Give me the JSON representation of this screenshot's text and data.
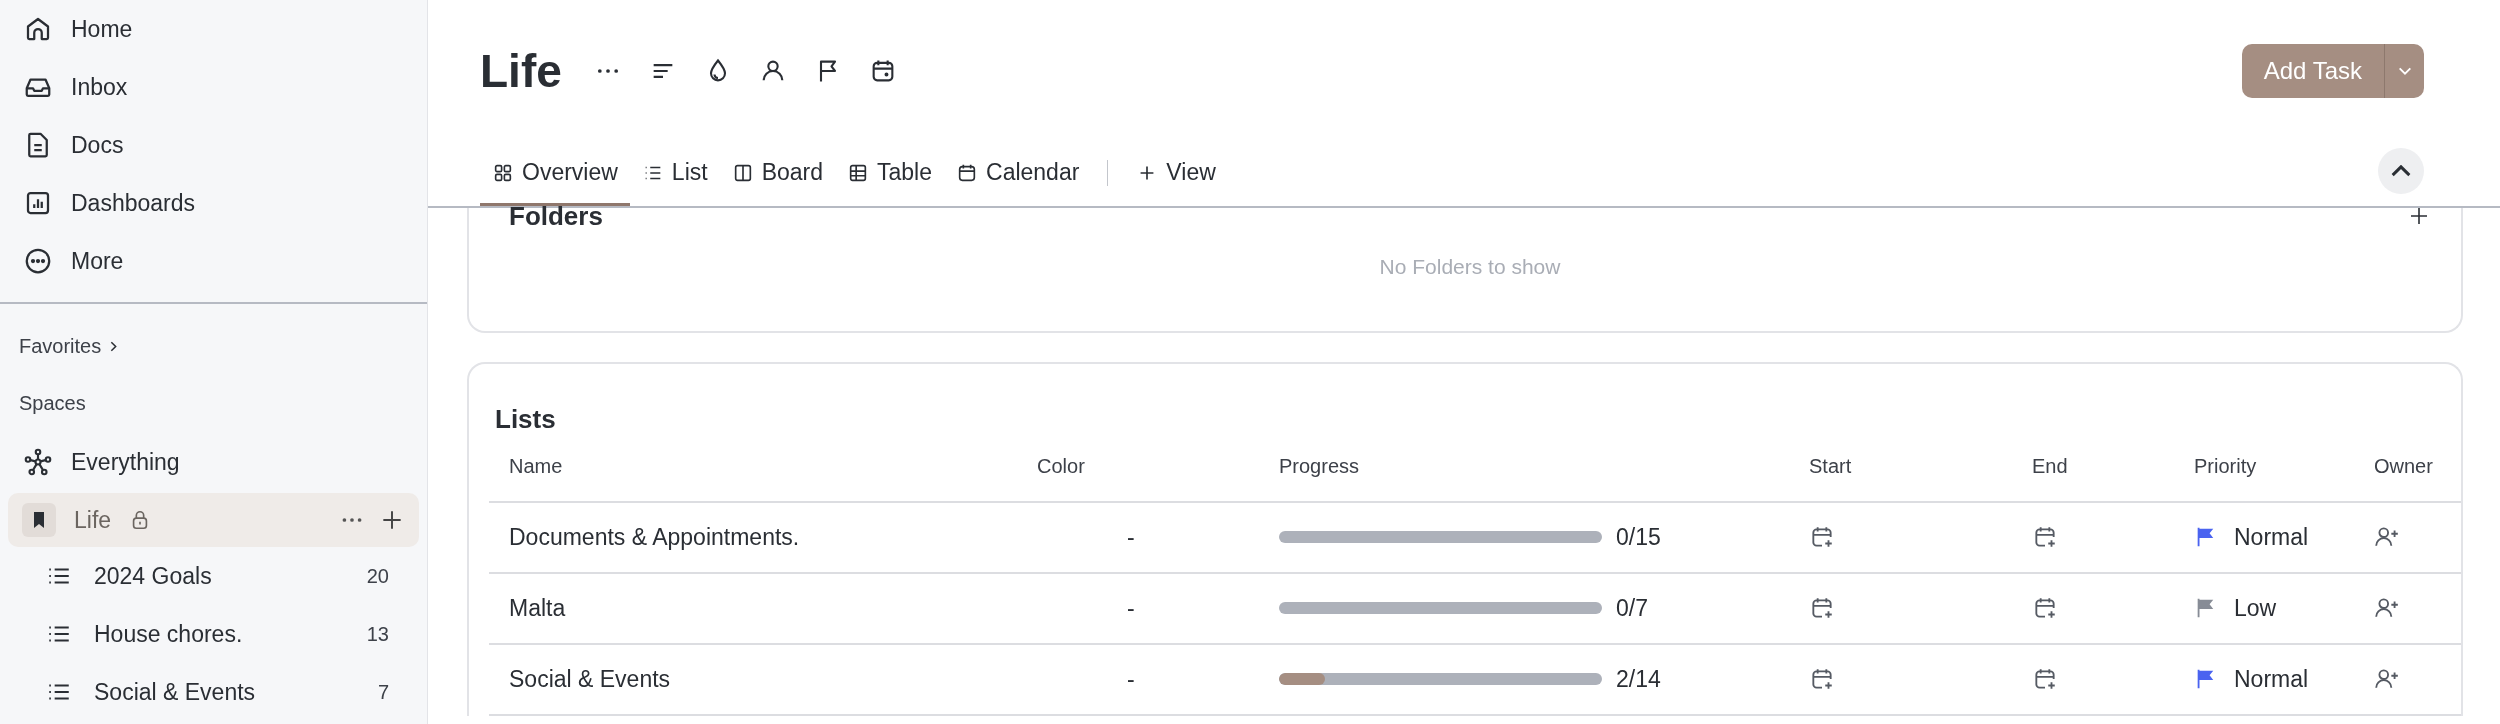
{
  "sidebar": {
    "nav": [
      {
        "label": "Home",
        "kind": "home"
      },
      {
        "label": "Inbox",
        "kind": "inbox"
      },
      {
        "label": "Docs",
        "kind": "docs"
      },
      {
        "label": "Dashboards",
        "kind": "dashboards"
      },
      {
        "label": "More",
        "kind": "more"
      }
    ],
    "favorites": {
      "label": "Favorites",
      "expanded": false
    },
    "spaces_label": "Spaces",
    "everything": "Everything",
    "space": {
      "name": "Life",
      "selected": true,
      "locked": true,
      "children": [
        {
          "name": "2024 Goals",
          "count": "20"
        },
        {
          "name": "House chores.",
          "count": "13"
        },
        {
          "name": "Social & Events",
          "count": "7"
        }
      ]
    }
  },
  "header": {
    "title": "Life",
    "add_task": "Add Task"
  },
  "tabs": [
    {
      "label": "Overview",
      "kind": "overview",
      "selected": true
    },
    {
      "label": "List",
      "kind": "list",
      "selected": false
    },
    {
      "label": "Board",
      "kind": "board",
      "selected": false
    },
    {
      "label": "Table",
      "kind": "table",
      "selected": false
    },
    {
      "label": "Calendar",
      "kind": "calendar",
      "selected": false
    }
  ],
  "add_view": "View",
  "folders": {
    "title": "Folders",
    "empty": "No Folders to show"
  },
  "lists": {
    "title": "Lists",
    "columns": [
      "Name",
      "Color",
      "Progress",
      "Start",
      "End",
      "Priority",
      "Owner"
    ],
    "rows": [
      {
        "name": "Documents & Appointments.",
        "color_cell": "-",
        "level": 0,
        "progress": "0/15",
        "priority": {
          "label": "Normal",
          "color": "#4a63f0"
        }
      },
      {
        "name": "Malta",
        "color_cell": "-",
        "level": 0,
        "progress": "0/7",
        "priority": {
          "label": "Low",
          "color": "#878c96"
        }
      },
      {
        "name": "Social & Events",
        "color_cell": "-",
        "level": 0.143,
        "progress": "2/14",
        "priority": {
          "label": "Normal",
          "color": "#4a63f0"
        }
      }
    ]
  }
}
